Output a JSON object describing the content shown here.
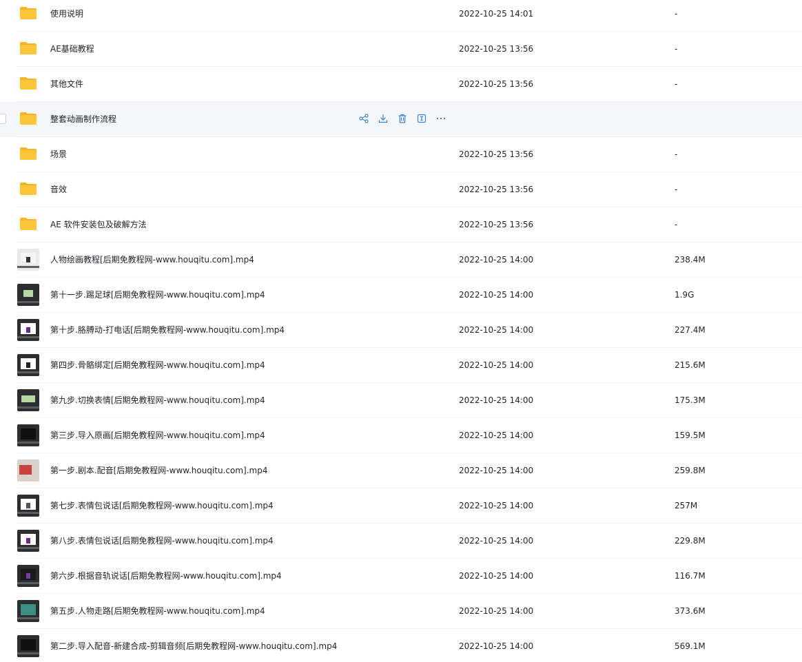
{
  "rows": [
    {
      "name": "使用说明",
      "date": "2022-10-25 14:01",
      "size": "-",
      "icon": "folder-icon"
    },
    {
      "name": "AE基础教程",
      "date": "2022-10-25 13:56",
      "size": "-",
      "icon": "folder-icon"
    },
    {
      "name": "其他文件",
      "date": "2022-10-25 13:56",
      "size": "-",
      "icon": "folder-icon"
    },
    {
      "name": "整套动画制作流程",
      "date": "",
      "size": "",
      "icon": "folder-icon",
      "hovered": true,
      "actions": [
        "share-icon",
        "download-icon",
        "delete-icon",
        "rename-icon",
        "more-icon"
      ]
    },
    {
      "name": "场景",
      "date": "2022-10-25 13:56",
      "size": "-",
      "icon": "folder-icon"
    },
    {
      "name": "音效",
      "date": "2022-10-25 13:56",
      "size": "-",
      "icon": "folder-icon"
    },
    {
      "name": "AE 软件安装包及破解方法",
      "date": "2022-10-25 13:56",
      "size": "-",
      "icon": "folder-icon"
    },
    {
      "name": "人物绘画教程[后期免教程网-www.houqitu.com].mp4",
      "date": "2022-10-25 14:00",
      "size": "238.4M",
      "icon": "video-thumbnail-icon"
    },
    {
      "name": "第十一步.踢足球[后期免教程网-www.houqitu.com].mp4",
      "date": "2022-10-25 14:00",
      "size": "1.9G",
      "icon": "video-thumbnail-icon"
    },
    {
      "name": "第十步.胳膊动-打电话[后期免教程网-www.houqitu.com].mp4",
      "date": "2022-10-25 14:00",
      "size": "227.4M",
      "icon": "video-thumbnail-icon"
    },
    {
      "name": "第四步.骨骼绑定[后期免教程网-www.houqitu.com].mp4",
      "date": "2022-10-25 14:00",
      "size": "215.6M",
      "icon": "video-thumbnail-icon"
    },
    {
      "name": "第九步.切换表情[后期免教程网-www.houqitu.com].mp4",
      "date": "2022-10-25 14:00",
      "size": "175.3M",
      "icon": "video-thumbnail-icon"
    },
    {
      "name": "第三步.导入原画[后期免教程网-www.houqitu.com].mp4",
      "date": "2022-10-25 14:00",
      "size": "159.5M",
      "icon": "video-thumbnail-icon"
    },
    {
      "name": "第一步.剧本.配音[后期免教程网-www.houqitu.com].mp4",
      "date": "2022-10-25 14:00",
      "size": "259.8M",
      "icon": "video-thumbnail-icon"
    },
    {
      "name": "第七步.表情包说话[后期免教程网-www.houqitu.com].mp4",
      "date": "2022-10-25 14:00",
      "size": "257M",
      "icon": "video-thumbnail-icon"
    },
    {
      "name": "第八步.表情包说话[后期免教程网-www.houqitu.com].mp4",
      "date": "2022-10-25 14:00",
      "size": "229.8M",
      "icon": "video-thumbnail-icon"
    },
    {
      "name": "第六步.根据音轨说话[后期免教程网-www.houqitu.com].mp4",
      "date": "2022-10-25 14:00",
      "size": "116.7M",
      "icon": "video-thumbnail-icon"
    },
    {
      "name": "第五步.人物走路[后期免教程网-www.houqitu.com].mp4",
      "date": "2022-10-25 14:00",
      "size": "373.6M",
      "icon": "video-thumbnail-icon"
    },
    {
      "name": "第二步.导入配音-新建合成-剪辑音频[后期免教程网-www.houqitu.com].mp4",
      "date": "2022-10-25 14:00",
      "size": "569.1M",
      "icon": "video-thumbnail-icon"
    }
  ],
  "colors": {
    "folder": "#fcc63a",
    "folder_back": "#f5b52a",
    "action": "#3b82d6",
    "hover_row": "#f5f6f9"
  }
}
